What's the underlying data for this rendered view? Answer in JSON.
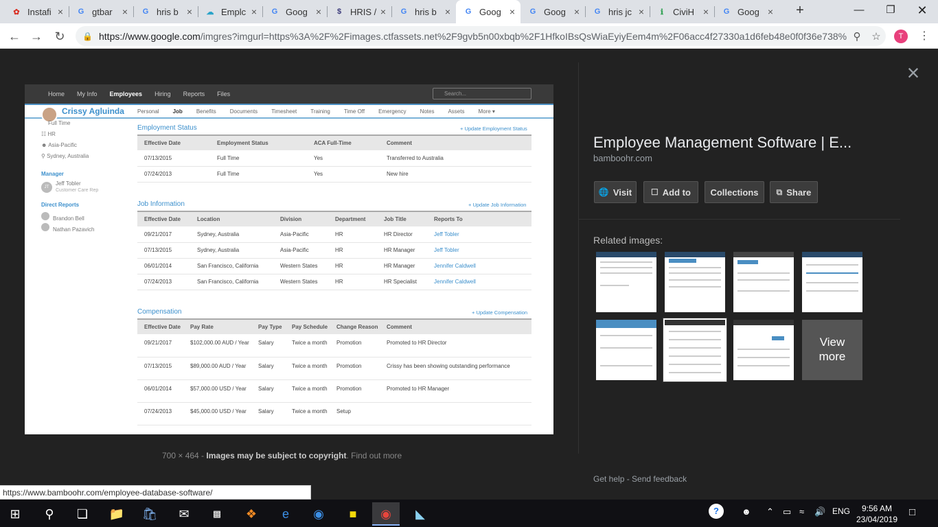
{
  "browser": {
    "tabs": [
      {
        "title": "Instafi",
        "icon": "bamboo-icon",
        "color": "#d93025"
      },
      {
        "title": "gtbar",
        "icon": "google-icon",
        "color": "#4285f4"
      },
      {
        "title": "hris b",
        "icon": "google-icon",
        "color": "#4285f4"
      },
      {
        "title": "Emplc",
        "icon": "cloud-icon",
        "color": "#29a3c9"
      },
      {
        "title": "Goog",
        "icon": "google-icon",
        "color": "#4285f4"
      },
      {
        "title": "HRIS /",
        "icon": "dollar-icon",
        "color": "#3b3a7a"
      },
      {
        "title": "hris b",
        "icon": "google-icon",
        "color": "#4285f4"
      },
      {
        "title": "Goog",
        "icon": "google-icon",
        "color": "#4285f4",
        "active": true
      },
      {
        "title": "Goog",
        "icon": "google-icon",
        "color": "#4285f4"
      },
      {
        "title": "hris jc",
        "icon": "google-icon",
        "color": "#4285f4"
      },
      {
        "title": "CiviH",
        "icon": "civihr-icon",
        "color": "#3ba55c"
      },
      {
        "title": "Goog",
        "icon": "google-icon",
        "color": "#4285f4"
      }
    ],
    "url_host": "https://www.google.com",
    "url_rest": "/imgres?imgurl=https%3A%2F%2Fimages.ctfassets.net%2F9gvb5n00xbqb%2F1HfkoIBsQsWiaEyiyEem4m%2F06acc4f27330a1d6feb48e0f0f36e738%...",
    "profile_initial": "T",
    "status_url": "https://www.bamboohr.com/employee-database-software/"
  },
  "viewer": {
    "caption_size": "700 × 464",
    "caption_sep": " - ",
    "caption_copyright": "Images may be subject to copyright",
    "caption_find": ". Find out more",
    "title": "Employee Management Software | E...",
    "site": "bamboohr.com",
    "buttons": [
      {
        "label": "Visit",
        "icon": "globe-icon"
      },
      {
        "label": "Add to",
        "icon": "bookmark-icon"
      },
      {
        "label": "Collections",
        "icon": ""
      },
      {
        "label": "Share",
        "icon": "share-icon"
      }
    ],
    "related_label": "Related images:",
    "view_more_line1": "View",
    "view_more_line2": "more",
    "help": "Get help",
    "help_sep": " - ",
    "feedback": "Send feedback"
  },
  "shot": {
    "topnav": [
      "Home",
      "My Info",
      "Employees",
      "Hiring",
      "Reports",
      "Files"
    ],
    "topnav_active": "Employees",
    "search_placeholder": "Search...",
    "employee_name": "Crissy Agluinda",
    "subnav": [
      "Personal",
      "Job",
      "Benefits",
      "Documents",
      "Timesheet",
      "Training",
      "Time Off",
      "Emergency",
      "Notes",
      "Assets",
      "More ▾"
    ],
    "subnav_active": "Job",
    "side": {
      "type": "Full Time",
      "dept": "HR",
      "division": "Asia-Pacific",
      "location": "Sydney, Australia",
      "manager_label": "Manager",
      "manager_initials": "JT",
      "manager_name": "Jeff Tobler",
      "manager_title": "Customer Care Rep",
      "reports_label": "Direct Reports",
      "report1": "Brandon Bell",
      "report2": "Nathan Pazavich"
    },
    "employment": {
      "title": "Employment Status",
      "update": "+ Update Employment Status",
      "headers": [
        "Effective Date",
        "Employment Status",
        "ACA Full-Time",
        "Comment"
      ],
      "rows": [
        [
          "07/13/2015",
          "Full Time",
          "Yes",
          "Transferred to Australia"
        ],
        [
          "07/24/2013",
          "Full Time",
          "Yes",
          "New hire"
        ]
      ]
    },
    "job": {
      "title": "Job Information",
      "update": "+ Update Job Information",
      "headers": [
        "Effective Date",
        "Location",
        "Division",
        "Department",
        "Job Title",
        "Reports To"
      ],
      "rows": [
        [
          "09/21/2017",
          "Sydney, Australia",
          "Asia-Pacific",
          "HR",
          "HR Director",
          "Jeff Tobler"
        ],
        [
          "07/13/2015",
          "Sydney, Australia",
          "Asia-Pacific",
          "HR",
          "HR Manager",
          "Jeff Tobler"
        ],
        [
          "06/01/2014",
          "San Francisco, California",
          "Western States",
          "HR",
          "HR Manager",
          "Jennifer Caldwell"
        ],
        [
          "07/24/2013",
          "San Francisco, California",
          "Western States",
          "HR",
          "HR Specialist",
          "Jennifer Caldwell"
        ]
      ]
    },
    "comp": {
      "title": "Compensation",
      "update": "+ Update Compensation",
      "headers": [
        "Effective Date",
        "Pay Rate",
        "Pay Type",
        "Pay Schedule",
        "Change Reason",
        "Comment"
      ],
      "rows": [
        [
          "09/21/2017",
          "$102,000.00 AUD / Year",
          "Salary",
          "Twice a month",
          "Promotion",
          "Promoted to HR Director"
        ],
        [
          "07/13/2015",
          "$89,000.00 AUD / Year",
          "Salary",
          "Twice a month",
          "Promotion",
          "Crissy has been showing outstanding performance"
        ],
        [
          "06/01/2014",
          "$57,000.00 USD / Year",
          "Salary",
          "Twice a month",
          "Promotion",
          "Promoted to HR Manager"
        ],
        [
          "07/24/2013",
          "$45,000.00 USD / Year",
          "Salary",
          "Twice a month",
          "Setup",
          ""
        ]
      ]
    }
  },
  "taskbar": {
    "lang": "ENG",
    "time": "9:56 AM",
    "date": "23/04/2019"
  }
}
